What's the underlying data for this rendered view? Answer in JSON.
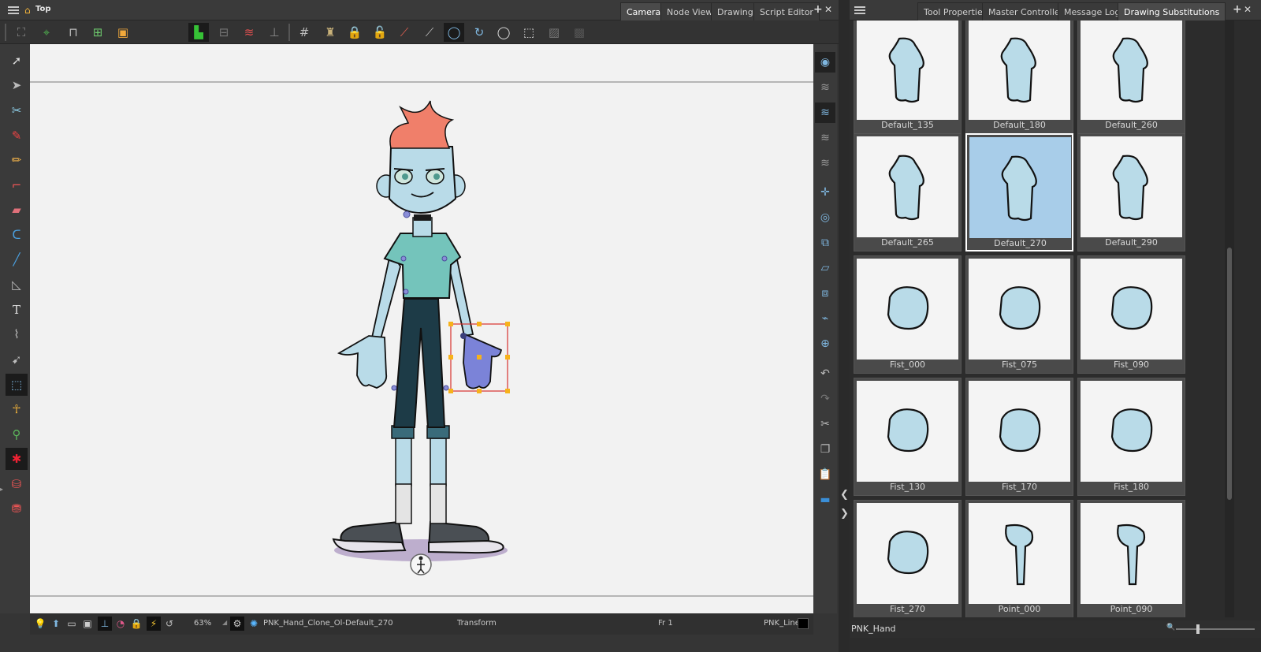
{
  "camera_panel": {
    "header_label": "Top",
    "tabs": [
      "Camera",
      "Node View",
      "Drawing",
      "Script Editor"
    ],
    "active_tab": "Camera",
    "add_tab": "+",
    "close_tab": "✕"
  },
  "statusbar": {
    "zoom": "63%",
    "drawing_name": "PNK_Hand_Clone_Ol-Default_270",
    "tool_name": "Transform",
    "frame": "Fr 1",
    "color_name": "PNK_Line"
  },
  "library_panel": {
    "tabs": [
      "Tool Properties",
      "Master Controller",
      "Message Log",
      "Drawing Substitutions"
    ],
    "active_tab": "Drawing Substitutions",
    "add_tab": "+",
    "close_tab": "✕",
    "selected_element": "PNK_Hand",
    "selected_drawing": "Default_270",
    "thumbnails": [
      {
        "label": "Default_135"
      },
      {
        "label": "Default_180"
      },
      {
        "label": "Default_260"
      },
      {
        "label": "Default_265"
      },
      {
        "label": "Default_270"
      },
      {
        "label": "Default_290"
      },
      {
        "label": "Fist_000"
      },
      {
        "label": "Fist_075"
      },
      {
        "label": "Fist_090"
      },
      {
        "label": "Fist_130"
      },
      {
        "label": "Fist_170"
      },
      {
        "label": "Fist_180"
      },
      {
        "label": "Fist_270"
      },
      {
        "label": "Point_000"
      },
      {
        "label": "Point_090"
      }
    ]
  },
  "colors": {
    "skin": "#b9dbe8",
    "hair": "#f07f6a",
    "shirt": "#74c4bb",
    "pants": "#1d3b47",
    "selection_hand": "#7b83d8",
    "selected_thumb_bg": "#a8cde9",
    "bbox_stroke": "#d8322d",
    "bbox_handle": "#f7b21b"
  },
  "icons": {
    "toolbar": [
      "select-icon",
      "contour-icon",
      "cutter-icon",
      "add-keyframe-icon",
      "transform-box-icon",
      "color-dropdown",
      "flip-icon",
      "align-icon",
      "motion-icon",
      "pivot-icon",
      "grid-icon",
      "lamp-icon",
      "lock-icon",
      "lock-add-icon",
      "perspective-icon",
      "ruler-icon",
      "rotate-ccw-icon",
      "rotate-cw-icon",
      "circle-icon",
      "cursor-box-icon",
      "camera-mask-icon",
      "mask-icon"
    ],
    "tools": [
      "select-arrow-icon",
      "contour-editor-icon",
      "cutter-icon",
      "brush-icon",
      "pencil-icon",
      "paint-icon",
      "eraser-icon",
      "lasso-icon",
      "line-icon",
      "polyline-icon",
      "text-icon",
      "dropper-icon",
      "pivot-tool-icon",
      "transform-tool-icon",
      "bone-icon",
      "ik-icon",
      "red-bone-icon",
      "deform-icon",
      "deform-add-icon"
    ],
    "view_tools": [
      "onion-eye-icon",
      "layers-icon",
      "layers-light-icon",
      "layers-icon",
      "layers-icon",
      "center-pivot-icon",
      "rotate-icon",
      "scale-icon",
      "skew-icon",
      "flip-h-icon",
      "smooth-icon",
      "morph-icon",
      "undo-icon",
      "redo-icon",
      "cut-icon",
      "copy-icon",
      "paste-icon",
      "ruler-view-icon"
    ],
    "status": [
      "lightbulb-icon",
      "pedestal-icon",
      "frame-icon",
      "safe-area-icon",
      "peg-icon",
      "onion-skin-icon",
      "lock-icon",
      "flash-icon",
      "reset-icon",
      "gear-icon",
      "settings-blue-icon"
    ]
  }
}
